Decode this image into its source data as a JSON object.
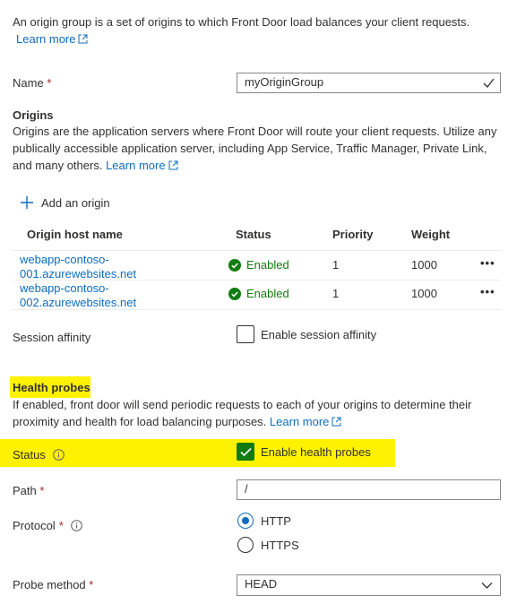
{
  "intro": {
    "text": "An origin group is a set of origins to which Front Door load balances your client requests.",
    "learn_more": "Learn more"
  },
  "name_field": {
    "label": "Name",
    "required_mark": "*",
    "value": "myOriginGroup"
  },
  "origins": {
    "heading": "Origins",
    "description": "Origins are the application servers where Front Door will route your client requests. Utilize any publically accessible application server, including App Service, Traffic Manager, Private Link, and many others.",
    "learn_more": "Learn more",
    "add_label": "Add an origin",
    "columns": [
      "Origin host name",
      "Status",
      "Priority",
      "Weight"
    ],
    "rows": [
      {
        "host_line1": "webapp-contoso-",
        "host_line2": "001.azurewebsites.net",
        "status": "Enabled",
        "priority": "1",
        "weight": "1000",
        "more": "•••"
      },
      {
        "host_line1": "webapp-contoso-",
        "host_line2": "002.azurewebsites.net",
        "status": "Enabled",
        "priority": "1",
        "weight": "1000",
        "more": "•••"
      }
    ]
  },
  "session_affinity": {
    "label": "Session affinity",
    "checkbox_label": "Enable session affinity",
    "checked": false
  },
  "health_probes": {
    "heading": "Health probes",
    "description": "If enabled, front door will send periodic requests to each of your origins to determine their proximity and health for load balancing purposes.",
    "learn_more": "Learn more",
    "status_label": "Status",
    "enable_label": "Enable health probes",
    "enabled": true,
    "path_label": "Path",
    "path_value": "/",
    "protocol_label": "Protocol",
    "protocol_options": [
      "HTTP",
      "HTTPS"
    ],
    "protocol_selected": "HTTP",
    "probe_method_label": "Probe method",
    "probe_method_value": "HEAD",
    "required_mark": "*"
  },
  "colors": {
    "link": "#0f6cbd",
    "required": "#a4262c",
    "success": "#107c10",
    "highlight": "#fff200"
  }
}
